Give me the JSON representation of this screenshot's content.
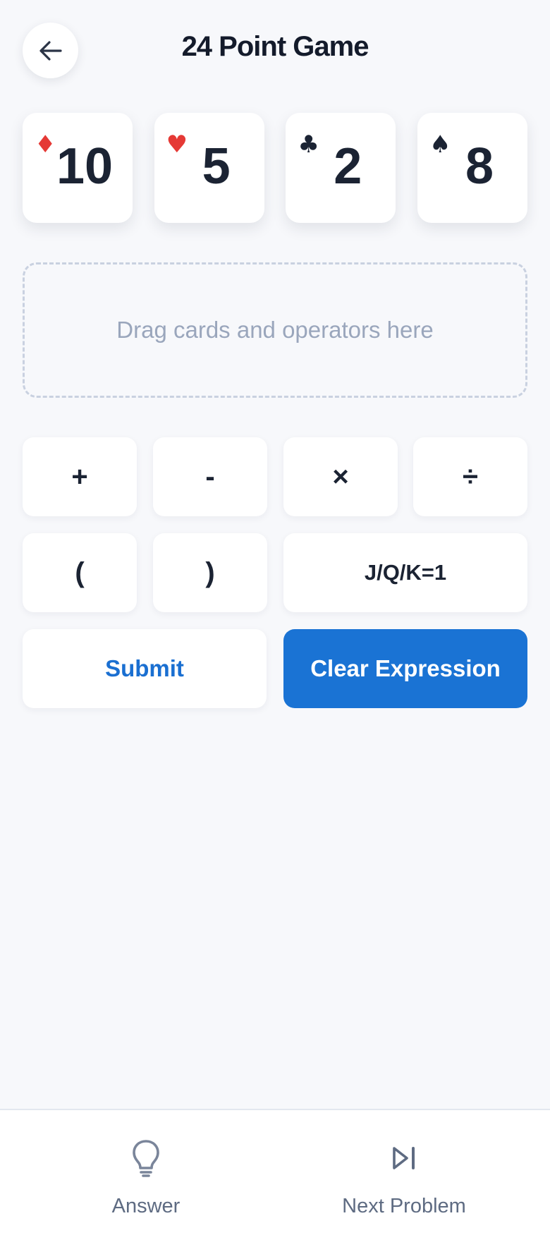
{
  "header": {
    "title": "24 Point Game"
  },
  "cards": [
    {
      "suit_glyph": "♦",
      "suit": "diamond",
      "rank": "10",
      "suit_color": "#e53935"
    },
    {
      "suit_glyph": "♥",
      "suit": "heart",
      "rank": "5",
      "suit_color": "#e53935"
    },
    {
      "suit_glyph": "♣",
      "suit": "club",
      "rank": "2",
      "suit_color": "#1b2333"
    },
    {
      "suit_glyph": "♠",
      "suit": "spade",
      "rank": "8",
      "suit_color": "#1b2333"
    }
  ],
  "dropzone": {
    "placeholder": "Drag cards and operators here"
  },
  "operators": [
    "+",
    "-",
    "×",
    "÷"
  ],
  "parens": [
    "(",
    ")"
  ],
  "face_rule": "J/Q/K=1",
  "actions": {
    "submit": "Submit",
    "clear": "Clear Expression"
  },
  "bottom_nav": {
    "answer": "Answer",
    "next": "Next Problem"
  },
  "colors": {
    "accent": "#1a73d4",
    "red_suit": "#e53935",
    "text": "#1b2333"
  }
}
